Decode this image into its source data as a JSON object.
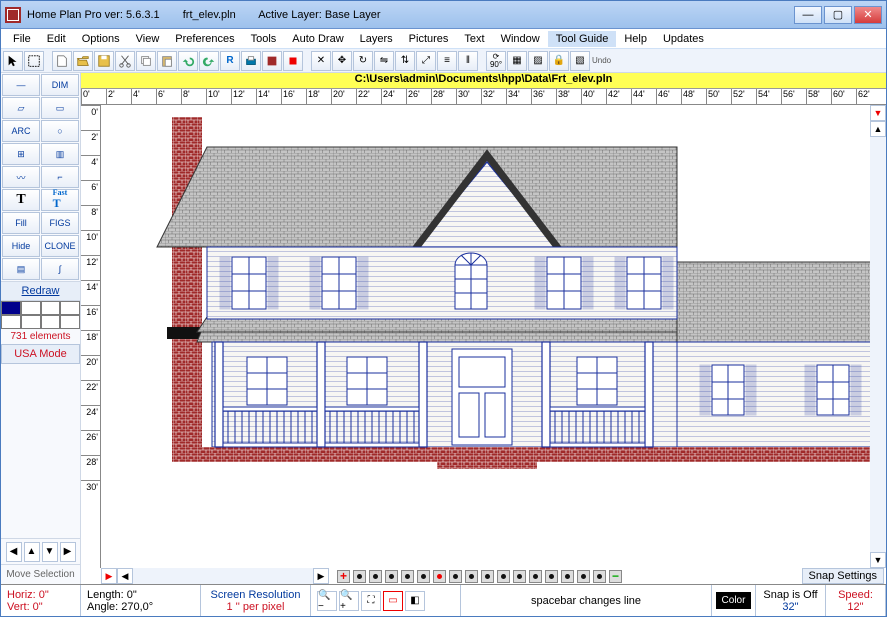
{
  "title": {
    "app": "Home Plan Pro ver: 5.6.3.1",
    "file": "frt_elev.pln",
    "layer": "Active Layer: Base Layer"
  },
  "menu": [
    "File",
    "Edit",
    "Options",
    "View",
    "Preferences",
    "Tools",
    "Auto Draw",
    "Layers",
    "Pictures",
    "Text",
    "Window",
    "Tool Guide",
    "Help",
    "Updates"
  ],
  "path_bar": "C:\\Users\\admin\\Documents\\hpp\\Data\\Frt_elev.pln",
  "ruler_h": [
    "0'",
    "2'",
    "4'",
    "6'",
    "8'",
    "10'",
    "12'",
    "14'",
    "16'",
    "18'",
    "20'",
    "22'",
    "24'",
    "26'",
    "28'",
    "30'",
    "32'",
    "34'",
    "36'",
    "38'",
    "40'",
    "42'",
    "44'",
    "46'",
    "48'",
    "50'",
    "52'",
    "54'",
    "56'",
    "58'",
    "60'",
    "62'"
  ],
  "ruler_v": [
    "0'",
    "2'",
    "4'",
    "6'",
    "8'",
    "10'",
    "12'",
    "14'",
    "16'",
    "18'",
    "20'",
    "22'",
    "24'",
    "26'",
    "28'",
    "30'"
  ],
  "tools": {
    "dim": "DIM",
    "arc": "ARC",
    "fast_t": "Fast",
    "fill": "Fill",
    "figs": "FIGS",
    "hide": "Hide",
    "clone": "CLONE",
    "redraw": "Redraw"
  },
  "element_count": "731 elements",
  "usa_mode": "USA Mode",
  "move_selection": "Move Selection",
  "snap_settings": "Snap Settings",
  "status": {
    "horiz": "Horiz: 0\"",
    "vert": "Vert: 0\"",
    "length": "Length:  0\"",
    "angle": "Angle: 270,0°",
    "resolution_label": "Screen Resolution",
    "resolution_value": "1 '' per pixel",
    "spacebar": "spacebar changes line",
    "color_btn": "Color",
    "snap_label": "Snap is Off",
    "snap_value": "32\"",
    "speed_label": "Speed:",
    "speed_value": "12\""
  },
  "undo_label": "Undo"
}
